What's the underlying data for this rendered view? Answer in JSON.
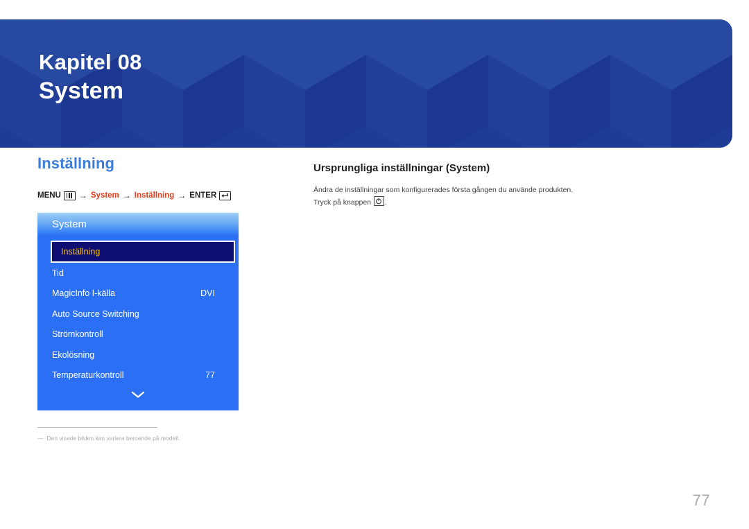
{
  "banner": {
    "chapter_label": "Kapitel 08",
    "chapter_title": "System",
    "bg_color": "#1e3c96"
  },
  "left": {
    "section_heading": "Inställning",
    "heading_color": "#3b7ddd",
    "breadcrumb": {
      "menu_label": "MENU",
      "menu_icon": "menu-bars-icon",
      "arrow": "→",
      "item1": "System",
      "item2": "Inställning",
      "enter_label": "ENTER",
      "enter_icon": "enter-return-icon",
      "accent_color": "#e03c1a"
    },
    "osd": {
      "title": "System",
      "panel_color": "#2b6ff5",
      "selected_bg": "#0d0d72",
      "selected_text_color": "#ffc400",
      "scroll_icon": "chevron-down-icon",
      "rows": [
        {
          "label": "Inställning",
          "value": "",
          "selected": true
        },
        {
          "label": "Tid",
          "value": "",
          "selected": false
        },
        {
          "label": "MagicInfo I-källa",
          "value": "DVI",
          "selected": false
        },
        {
          "label": "Auto Source Switching",
          "value": "",
          "selected": false
        },
        {
          "label": "Strömkontroll",
          "value": "",
          "selected": false
        },
        {
          "label": "Ekolösning",
          "value": "",
          "selected": false
        },
        {
          "label": "Temperaturkontroll",
          "value": "77",
          "selected": false
        }
      ]
    },
    "footnote": {
      "dash": "―",
      "text": "Den visade bilden kan variera beroende på modell."
    }
  },
  "right": {
    "heading": "Ursprungliga inställningar (System)",
    "body_line1": "Ändra de inställningar som konfigurerades första gången du använde produkten.",
    "body_line2_before": "Tryck på knappen",
    "body_button_icon": "power-button-icon",
    "body_line2_after": "."
  },
  "page_number": "77"
}
